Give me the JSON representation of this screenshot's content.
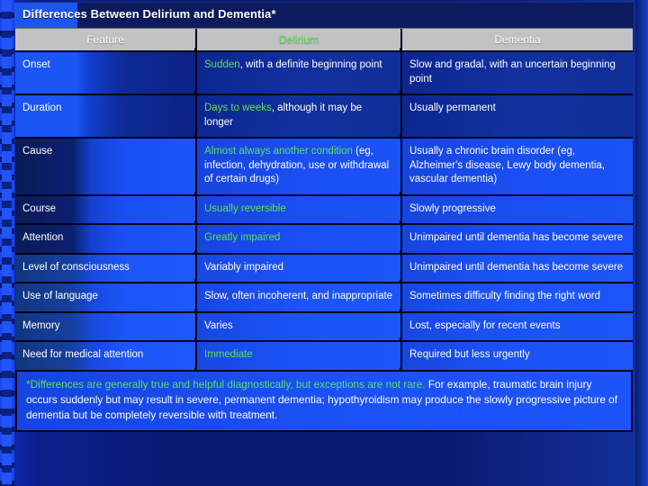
{
  "title": "Differences Between Delirium and Dementia*",
  "table": {
    "headers": [
      "Feature",
      "Delirium",
      "Dementia"
    ],
    "rows": [
      {
        "feature": "Onset",
        "delirium_green": "Sudden",
        "delirium_rest": ", with a definite beginning point",
        "dementia": "Slow and gradal, with an uncertain beginning point"
      },
      {
        "feature": "Duration",
        "delirium_green": "Days to weeks",
        "delirium_rest": ", although it may be longer",
        "dementia": "Usually permanent"
      },
      {
        "feature": "Cause",
        "delirium_green": "Almost always another condition",
        "delirium_rest": " (eg, infection, dehydration, use or withdrawal of certain drugs)",
        "dementia": "Usually a chronic brain disorder (eg, Alzheimer's disease, Lewy body dementia, vascular dementia)"
      },
      {
        "feature": "Course",
        "delirium_green": "Usually reversible",
        "delirium_rest": "",
        "dementia": "Slowly progressive"
      },
      {
        "feature": "Attention",
        "delirium_green": "Greatly impaired",
        "delirium_rest": "",
        "dementia": "Unimpaired until dementia has become severe"
      },
      {
        "feature": "Level of consciousness",
        "delirium_green": "",
        "delirium_rest": "Variably impaired",
        "dementia": "Unimpaired until dementia has become severe"
      },
      {
        "feature": "Use of language",
        "delirium_green": "",
        "delirium_rest": "Slow, often incoherent, and inappropriate",
        "dementia": "Sometimes difficulty finding the right word"
      },
      {
        "feature": "Memory",
        "delirium_green": "",
        "delirium_rest": "Varies",
        "dementia": "Lost, especially for recent events"
      },
      {
        "feature": "Need for medical attention",
        "delirium_green": "Immediate",
        "delirium_rest": "",
        "dementia": "Required but less urgently"
      }
    ]
  },
  "footnote": {
    "green": "*Differences are generally true and helpful diagnostically, but exceptions are not rare.",
    "rest": " For example, traumatic brain injury occurs suddenly but may result in severe, permanent dementia; hypothyroidism may produce the slowly progressive picture of dementia but be completely reversible with treatment."
  },
  "colors": {
    "background": "#0a1c72",
    "accent_blue": "#1e54f0",
    "highlight_green": "#5ce05c",
    "header_gray": "#c2c2c2",
    "text_white": "#ffffff"
  }
}
